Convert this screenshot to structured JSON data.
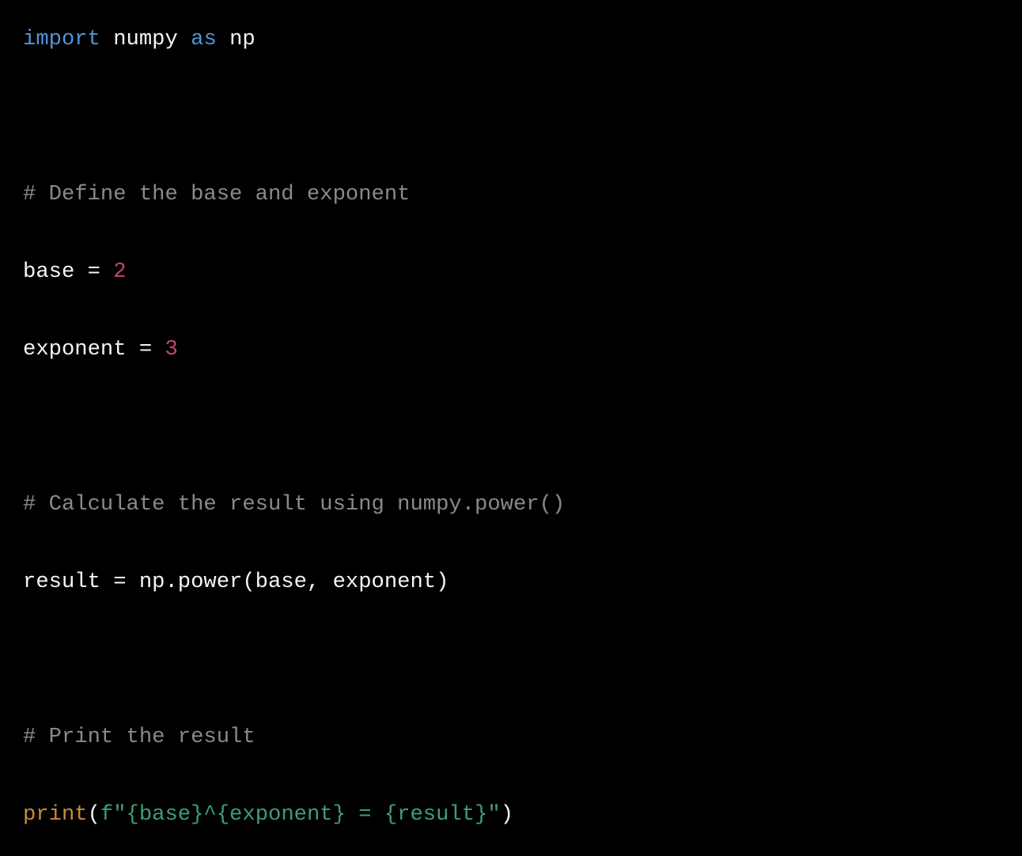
{
  "editor": {
    "background_color": "#000000",
    "default_text_color": "#f5f5f5",
    "language": "python",
    "font_size_px": 27,
    "line_height_px": 48
  },
  "theme": {
    "keyword_color": "#5294d6",
    "comment_color": "#8a8a8a",
    "number_color": "#c4456b",
    "builtin_color": "#c98a3c",
    "string_color": "#3f9e72",
    "plain_color": "#f5f5f5"
  },
  "code": {
    "full_text": "import numpy as np\n\n# Define the base and exponent\nbase = 2\nexponent = 3\n\n# Calculate the result using numpy.power()\nresult = np.power(base, exponent)\n\n# Print the result\nprint(f\"{base}^{exponent} = {result}\")",
    "lines": [
      {
        "index": 1,
        "text": "import numpy as np",
        "tokens": [
          {
            "text": "import",
            "type": "keyword"
          },
          {
            "text": " numpy ",
            "type": "plain"
          },
          {
            "text": "as",
            "type": "keyword"
          },
          {
            "text": " np",
            "type": "plain"
          }
        ]
      },
      {
        "index": 2,
        "text": "",
        "tokens": [
          {
            "text": " ",
            "type": "plain"
          }
        ]
      },
      {
        "index": 3,
        "text": "# Define the base and exponent",
        "tokens": [
          {
            "text": "# Define the base and exponent",
            "type": "comment"
          }
        ]
      },
      {
        "index": 4,
        "text": "base = 2",
        "tokens": [
          {
            "text": "base = ",
            "type": "plain"
          },
          {
            "text": "2",
            "type": "number"
          }
        ]
      },
      {
        "index": 5,
        "text": "exponent = 3",
        "tokens": [
          {
            "text": "exponent = ",
            "type": "plain"
          },
          {
            "text": "3",
            "type": "number"
          }
        ]
      },
      {
        "index": 6,
        "text": "",
        "tokens": [
          {
            "text": " ",
            "type": "plain"
          }
        ]
      },
      {
        "index": 7,
        "text": "# Calculate the result using numpy.power()",
        "tokens": [
          {
            "text": "# Calculate the result using numpy.power()",
            "type": "comment"
          }
        ]
      },
      {
        "index": 8,
        "text": "result = np.power(base, exponent)",
        "tokens": [
          {
            "text": "result = np.power(base, exponent)",
            "type": "plain"
          }
        ]
      },
      {
        "index": 9,
        "text": "",
        "tokens": [
          {
            "text": " ",
            "type": "plain"
          }
        ]
      },
      {
        "index": 10,
        "text": "# Print the result",
        "tokens": [
          {
            "text": "# Print the result",
            "type": "comment"
          }
        ]
      },
      {
        "index": 11,
        "text": "print(f\"{base}^{exponent} = {result}\")",
        "tokens": [
          {
            "text": "print",
            "type": "builtin"
          },
          {
            "text": "(",
            "type": "punct"
          },
          {
            "text": "f\"{base}^{exponent} = {result}\"",
            "type": "string"
          },
          {
            "text": ")",
            "type": "punct"
          }
        ]
      }
    ]
  }
}
